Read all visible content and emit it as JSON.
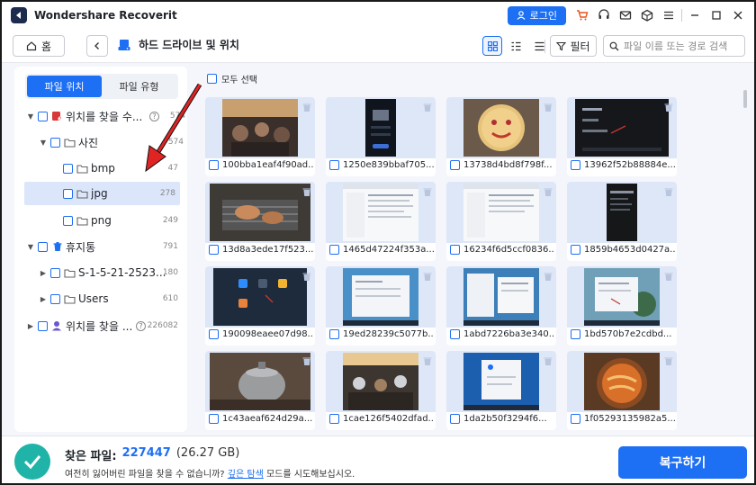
{
  "app": {
    "title": "Wondershare Recoverit",
    "login_label": "로그인"
  },
  "nav": {
    "home_label": "홈",
    "breadcrumb": "하드 드라이브 및 위치",
    "filter_label": "필터",
    "search_placeholder": "파일 이름 또는 경로 검색"
  },
  "sidebar": {
    "tabs": [
      "파일 위치",
      "파일 유형"
    ],
    "tree": [
      {
        "label": "위치를 찾을 수...",
        "count": "574"
      },
      {
        "label": "사진",
        "count": "574"
      },
      {
        "label": "bmp",
        "count": "47"
      },
      {
        "label": "jpg",
        "count": "278"
      },
      {
        "label": "png",
        "count": "249"
      },
      {
        "label": "휴지통",
        "count": "791"
      },
      {
        "label": "S-1-5-21-2523...",
        "count": "180"
      },
      {
        "label": "Users",
        "count": "610"
      },
      {
        "label": "위치를 찾을 ...",
        "count": "226082"
      }
    ]
  },
  "grid": {
    "select_all_label": "모두 선택",
    "files": [
      "100bba1eaf4f90ad...",
      "1250e839bbaf705...",
      "13738d4bd8f798f...",
      "13962f52b88884e...",
      "13d8a3ede17f523...",
      "1465d47224f353a...",
      "16234f6d5ccf0836...",
      "1859b4653d0427a...",
      "190098eaee07d98...",
      "19ed28239c5077b...",
      "1abd7226ba3e340...",
      "1bd570b7e2cdbd...",
      "1c43aeaf624d29a...",
      "1cae126f5402dfad...",
      "1da2b50f3294f6...",
      "1f05293135982a5..."
    ]
  },
  "footer": {
    "found_label": "찾은 파일:",
    "found_count": "227447",
    "found_size": "(26.27 GB)",
    "hint_before": "여전히 잃어버린 파일을 찾을 수 없습니까?",
    "hint_link": "깊은 탐색",
    "hint_after": "모드를 시도해보십시오.",
    "recover_label": "복구하기"
  }
}
